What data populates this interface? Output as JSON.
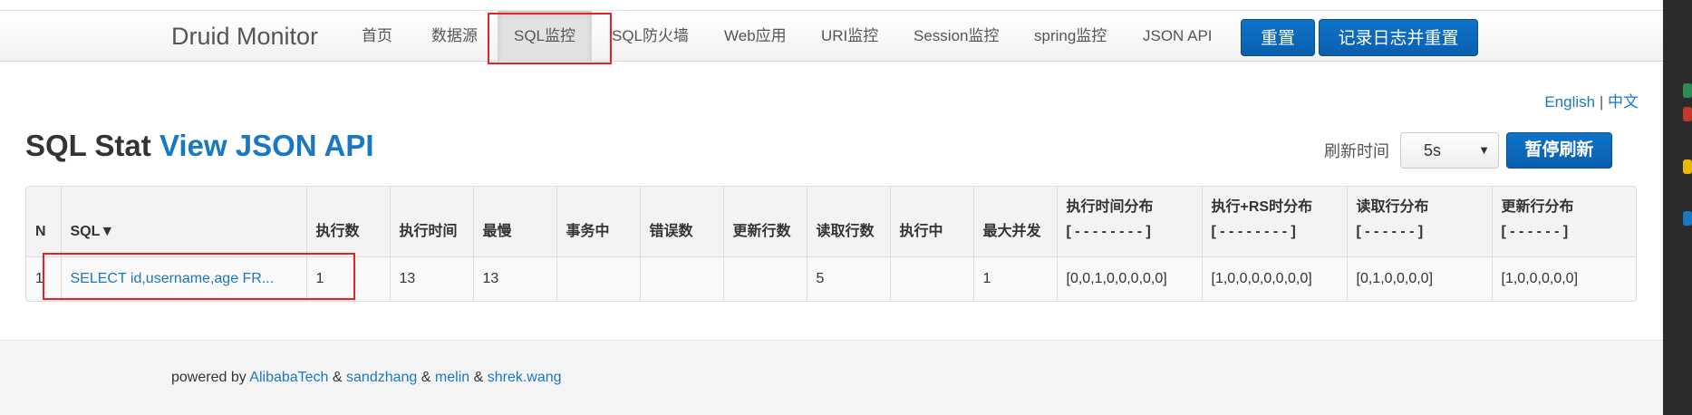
{
  "nav": {
    "brand": "Druid Monitor",
    "items": [
      "首页",
      "数据源",
      "SQL监控",
      "SQL防火墙",
      "Web应用",
      "URI监控",
      "Session监控",
      "spring监控",
      "JSON API"
    ],
    "active": "SQL监控",
    "reset_label": "重置",
    "log_reset_label": "记录日志并重置"
  },
  "lang": {
    "english": "English",
    "separator": "|",
    "chinese": "中文"
  },
  "title": {
    "prefix": "SQL Stat",
    "link": "View JSON API"
  },
  "refresh": {
    "label": "刷新时间",
    "value": "5s",
    "pause_label": "暂停刷新"
  },
  "table": {
    "headers": {
      "n": "N",
      "sql": "SQL▼",
      "exec_count": "执行数",
      "exec_time": "执行时间",
      "slowest": "最慢",
      "in_tx": "事务中",
      "errors": "错误数",
      "update_rows": "更新行数",
      "read_rows": "读取行数",
      "running": "执行中",
      "max_concurrent": "最大并发",
      "exec_time_dist": "执行时间分布",
      "exec_time_dist_sub": "[ - - - - - - - - ]",
      "exec_rs_dist": "执行+RS时分布",
      "exec_rs_dist_sub": "[ - - - - - - - - ]",
      "read_dist": "读取行分布",
      "read_dist_sub": "[ - - - - - - ]",
      "update_dist": "更新行分布",
      "update_dist_sub": "[ - - - - - - ]"
    },
    "rows": [
      {
        "n": "1",
        "sql": "SELECT id,username,age FR...",
        "exec_count": "1",
        "exec_time": "13",
        "slowest": "13",
        "in_tx": "",
        "errors": "",
        "update_rows": "",
        "read_rows": "5",
        "running": "",
        "max_concurrent": "1",
        "exec_time_dist": "[0,0,1,0,0,0,0,0]",
        "exec_rs_dist": "[1,0,0,0,0,0,0,0]",
        "read_dist": "[0,1,0,0,0,0]",
        "update_dist": "[1,0,0,0,0,0]"
      }
    ]
  },
  "footer": {
    "prefix": "powered by",
    "links": [
      "AlibabaTech",
      "sandzhang",
      "melin",
      "shrek.wang"
    ],
    "separator": "&"
  },
  "colors": {
    "link": "#1a78c2",
    "button": "#0a66b8",
    "highlight_box": "#e8202a"
  }
}
